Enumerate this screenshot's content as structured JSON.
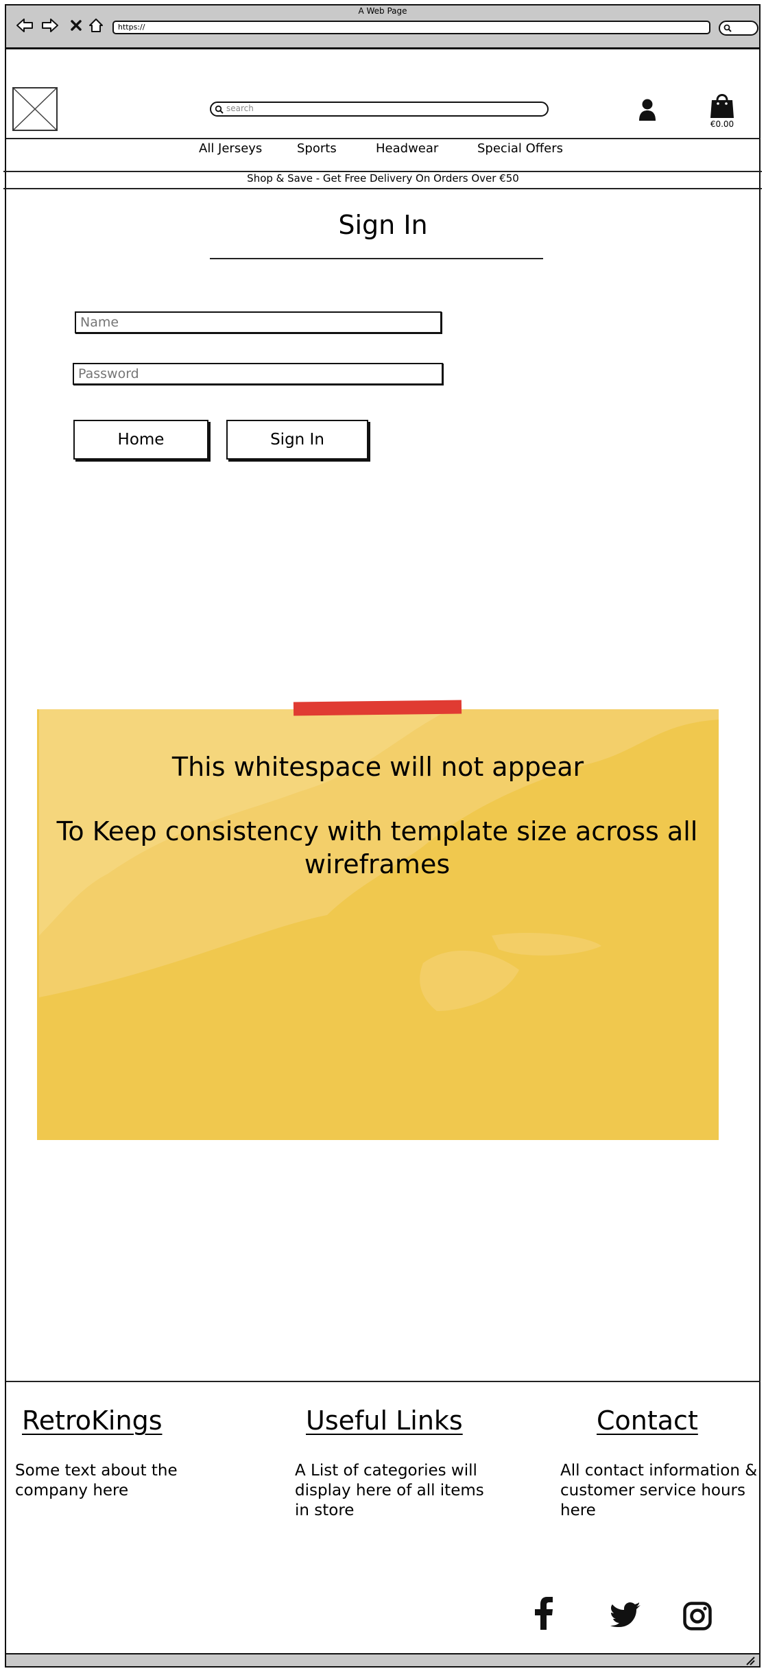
{
  "browser": {
    "window_title": "A Web Page",
    "address": "https://"
  },
  "header": {
    "search_placeholder": "search",
    "cart_total": "€0.00"
  },
  "nav": {
    "items": [
      "All Jerseys",
      "Sports",
      "Headwear",
      "Special Offers"
    ]
  },
  "promo": "Shop & Save - Get Free Delivery On Orders Over €50",
  "signin": {
    "title": "Sign In",
    "name_placeholder": "Name",
    "password_placeholder": "Password",
    "home_label": "Home",
    "signin_label": "Sign In"
  },
  "note": {
    "line1": "This whitespace will not appear",
    "line2": "To Keep consistency with template size across all wireframes"
  },
  "footer": {
    "col1": {
      "title": "RetroKings",
      "text": "Some text about the company here"
    },
    "col2": {
      "title": "Useful Links",
      "text": "A List of categories will display here of all items in store"
    },
    "col3": {
      "title": "Contact",
      "text": "All contact information & customer service hours here"
    }
  },
  "colors": {
    "chrome": "#c9c9c9",
    "note": "#f0c84e",
    "tape": "#e03b32"
  }
}
